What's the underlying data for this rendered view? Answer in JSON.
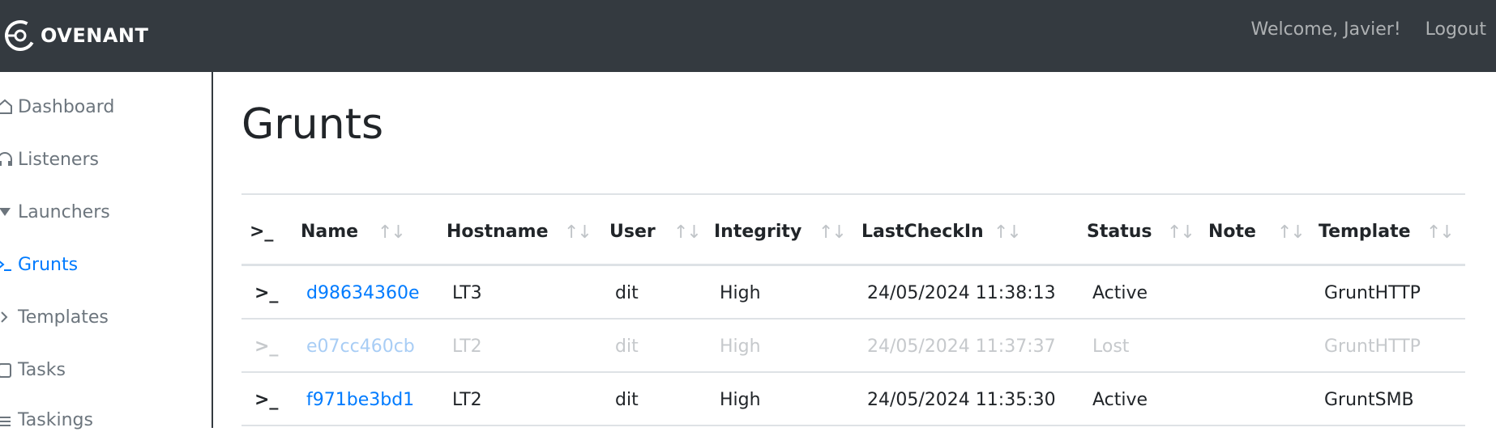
{
  "app": {
    "brand": "OVENANT",
    "welcome": "Welcome, Javier!",
    "logout": "Logout"
  },
  "sidebar": {
    "items": [
      {
        "label": "Dashboard",
        "icon": "home-icon",
        "active": false
      },
      {
        "label": "Listeners",
        "icon": "headphones-icon",
        "active": false
      },
      {
        "label": "Launchers",
        "icon": "rocket-icon",
        "active": false
      },
      {
        "label": "Grunts",
        "icon": "terminal-icon",
        "active": true
      },
      {
        "label": "Templates",
        "icon": "code-icon",
        "active": false
      },
      {
        "label": "Tasks",
        "icon": "clipboard-icon",
        "active": false
      },
      {
        "label": "Taskings",
        "icon": "tasks-icon",
        "active": false
      }
    ]
  },
  "page": {
    "title": "Grunts"
  },
  "table": {
    "terminal_symbol": ">_",
    "sort_symbol": "↑↓",
    "headers": {
      "name": "Name",
      "hostname": "Hostname",
      "user": "User",
      "integrity": "Integrity",
      "lastcheckin": "LastCheckIn",
      "status": "Status",
      "note": "Note",
      "template": "Template"
    },
    "rows": [
      {
        "name": "d98634360e",
        "hostname": "LT3",
        "user": "dit",
        "integrity": "High",
        "lastcheckin": "24/05/2024 11:38:13",
        "status": "Active",
        "note": "",
        "template": "GruntHTTP"
      },
      {
        "name": "e07cc460cb",
        "hostname": "LT2",
        "user": "dit",
        "integrity": "High",
        "lastcheckin": "24/05/2024 11:37:37",
        "status": "Lost",
        "note": "",
        "template": "GruntHTTP"
      },
      {
        "name": "f971be3bd1",
        "hostname": "LT2",
        "user": "dit",
        "integrity": "High",
        "lastcheckin": "24/05/2024 11:35:30",
        "status": "Active",
        "note": "",
        "template": "GruntSMB"
      }
    ]
  },
  "colors": {
    "topbar": "#343a40",
    "link": "#007bff",
    "muted": "#6c757d"
  }
}
